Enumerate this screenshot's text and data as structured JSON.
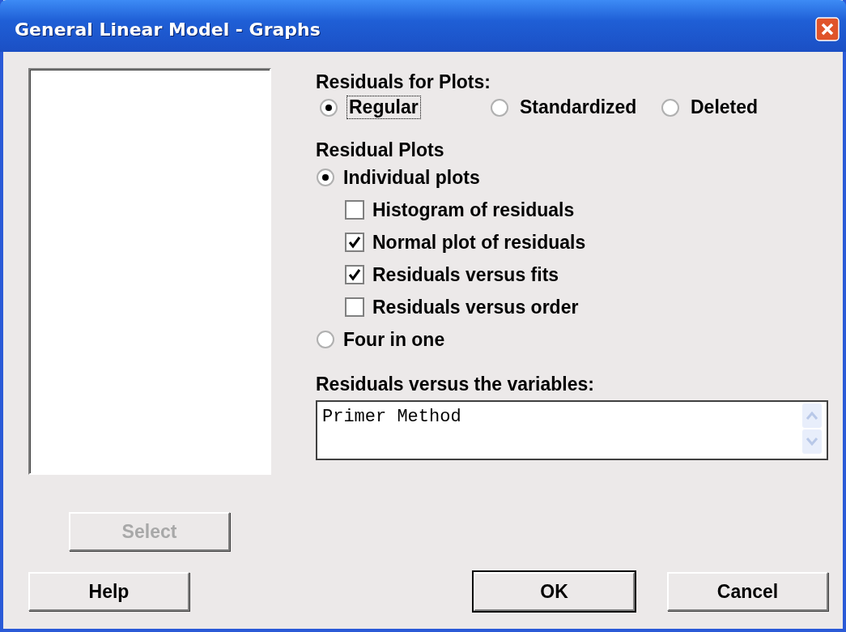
{
  "window": {
    "title": "General Linear Model - Graphs"
  },
  "select_button": {
    "label": "Select",
    "disabled": true
  },
  "residuals_for_plots": {
    "label": "Residuals for Plots:",
    "options": [
      {
        "label": "Regular",
        "selected": true,
        "focused": true
      },
      {
        "label": "Standardized",
        "selected": false,
        "focused": false
      },
      {
        "label": "Deleted",
        "selected": false,
        "focused": false
      }
    ]
  },
  "residual_plots": {
    "label": "Residual Plots",
    "options": [
      {
        "label": "Individual plots",
        "selected": true,
        "children": [
          {
            "label": "Histogram of residuals",
            "checked": false
          },
          {
            "label": "Normal plot of residuals",
            "checked": true
          },
          {
            "label": "Residuals versus fits",
            "checked": true
          },
          {
            "label": "Residuals versus order",
            "checked": false
          }
        ]
      },
      {
        "label": "Four in one",
        "selected": false
      }
    ]
  },
  "variables_field": {
    "label": "Residuals versus the variables:",
    "value": "Primer Method"
  },
  "buttons": [
    {
      "label": "Help",
      "kind": "normal"
    },
    {
      "label": "OK",
      "kind": "default"
    },
    {
      "label": "Cancel",
      "kind": "normal"
    }
  ]
}
